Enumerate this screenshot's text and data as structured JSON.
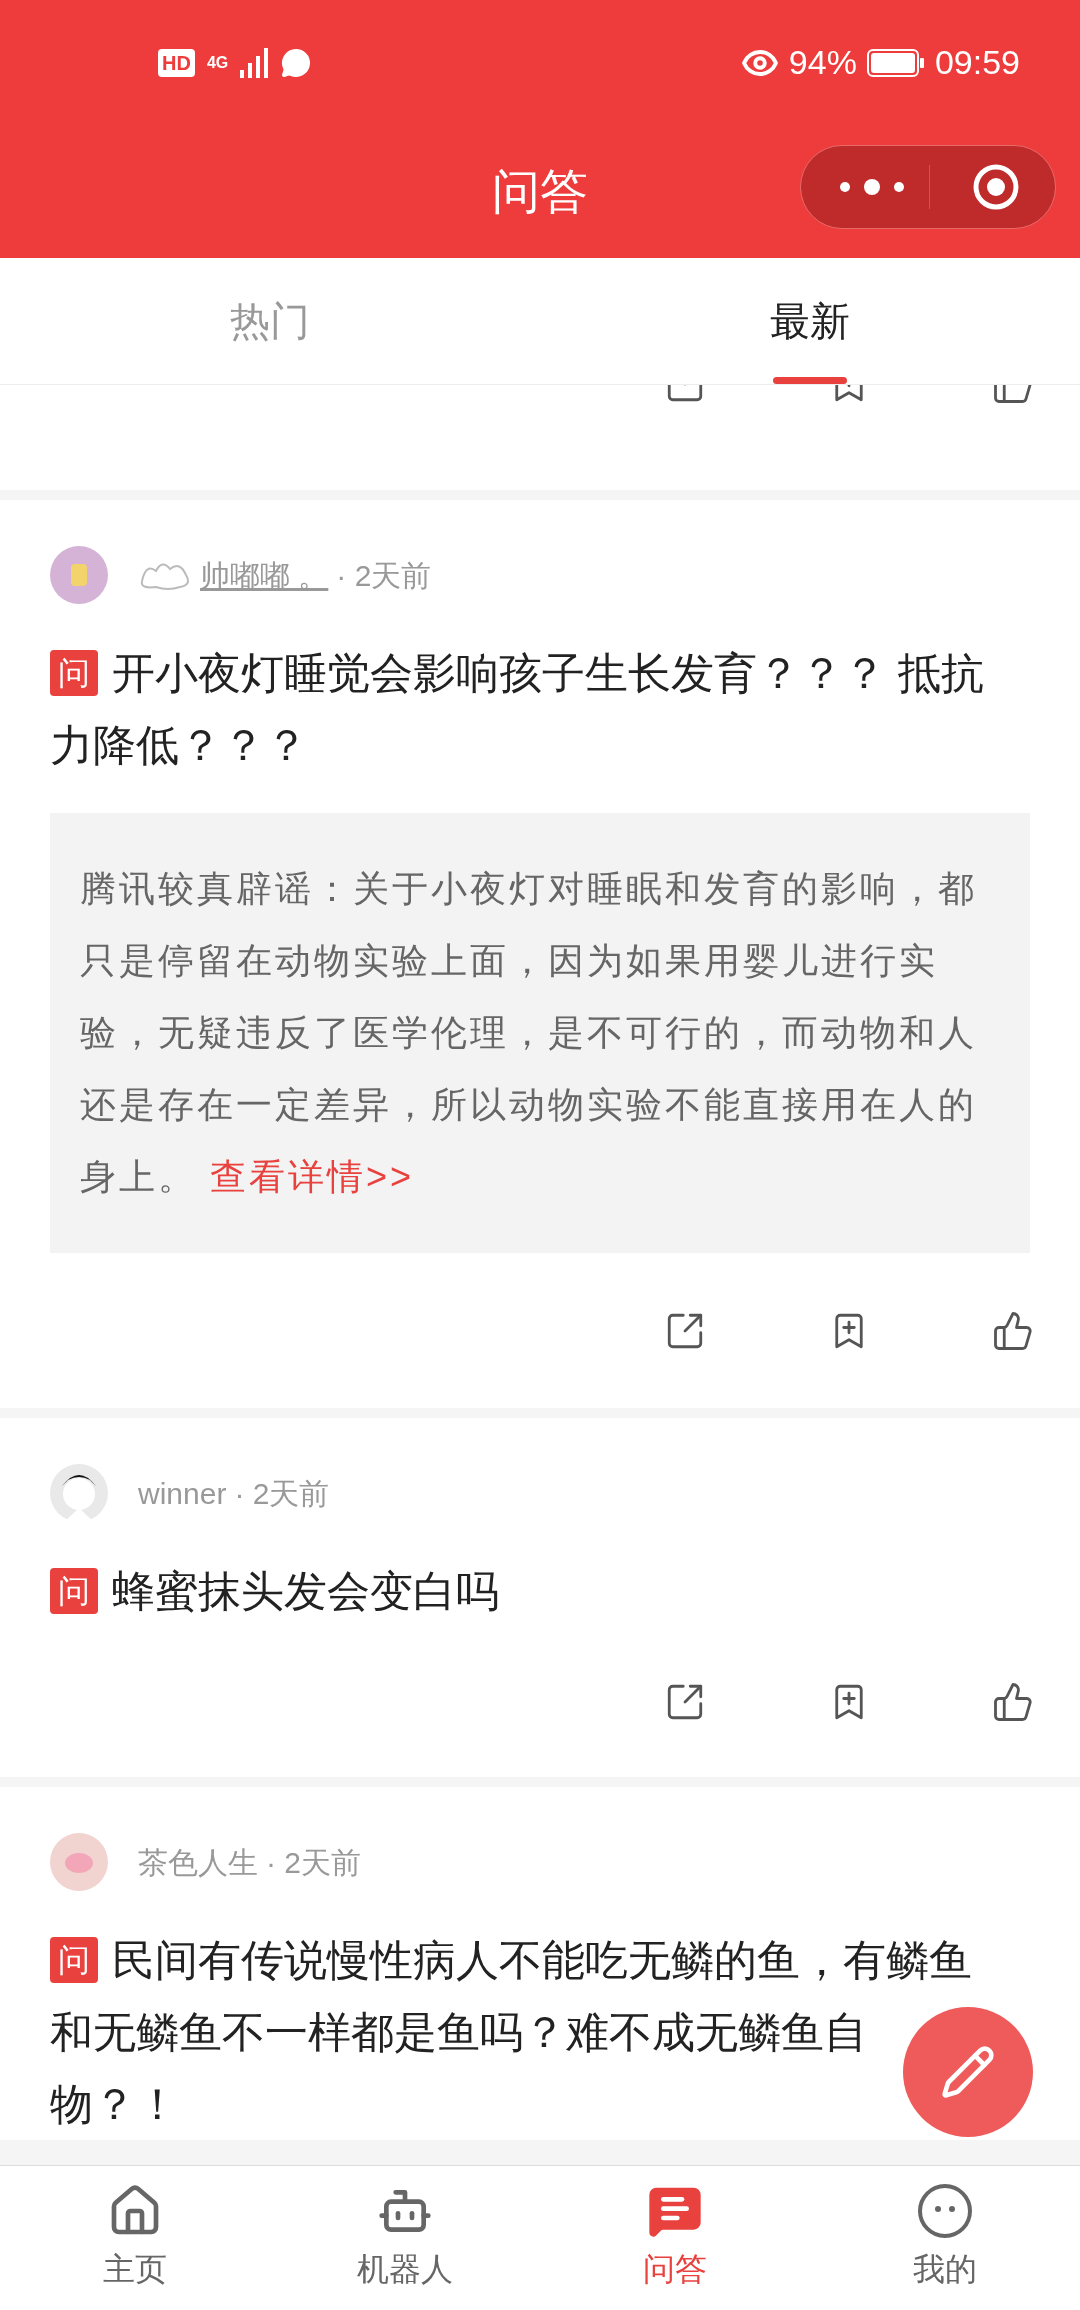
{
  "status_bar": {
    "hd": "HD",
    "network": "4G",
    "battery": "94%",
    "time": "09:59"
  },
  "header": {
    "title": "问答"
  },
  "tabs": [
    {
      "label": "热门",
      "selected": false
    },
    {
      "label": "最新",
      "selected": true
    }
  ],
  "posts": [
    {
      "author": "帅嘟嘟 。",
      "author_decorated": true,
      "time": "· 2天前",
      "badge": "问",
      "title": "开小夜灯睡觉会影响孩子生长发育？？？ 抵抗力降低？？？",
      "quote": {
        "text": "腾讯较真辟谣：关于小夜灯对睡眠和发育的影响，都只是停留在动物实验上面，因为如果用婴儿进行实验，无疑违反了医学伦理，是不可行的，而动物和人还是存在一定差异，所以动物实验不能直接用在人的身上。",
        "link": "查看详情>>"
      }
    },
    {
      "author": "winner",
      "author_decorated": false,
      "time": "· 2天前",
      "badge": "问",
      "title": "蜂蜜抹头发会变白吗"
    },
    {
      "author": "茶色人生",
      "author_decorated": false,
      "time": "· 2天前",
      "badge": "问",
      "title_lines": [
        "民间有传说慢性病人不能吃无鳞的鱼，有鳞鱼",
        "和无鳞鱼不一样都是鱼吗？难不成无鳞鱼自",
        "物？！"
      ]
    }
  ],
  "nav": [
    {
      "label": "主页",
      "selected": false
    },
    {
      "label": "机器人",
      "selected": false
    },
    {
      "label": "问答",
      "selected": true
    },
    {
      "label": "我的",
      "selected": false
    }
  ]
}
